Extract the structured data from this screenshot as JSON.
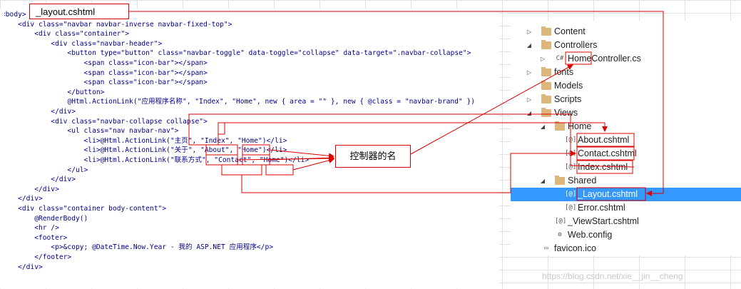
{
  "title_box": "_layout.cshtml",
  "callout": "控制器的名",
  "code_lines": [
    "<body>",
    "    <div class=\"navbar navbar-inverse navbar-fixed-top\">",
    "        <div class=\"container\">",
    "            <div class=\"navbar-header\">",
    "                <button type=\"button\" class=\"navbar-toggle\" data-toggle=\"collapse\" data-target=\".navbar-collapse\">",
    "                    <span class=\"icon-bar\"></span>",
    "                    <span class=\"icon-bar\"></span>",
    "                    <span class=\"icon-bar\"></span>",
    "                </button>",
    "                @Html.ActionLink(\"应用程序名称\", \"Index\", \"Home\", new { area = \"\" }, new { @class = \"navbar-brand\" })",
    "            </div>",
    "            <div class=\"navbar-collapse collapse\">",
    "                <ul class=\"nav navbar-nav\">",
    "                    <li>@Html.ActionLink(\"主页\", \"Index\", \"Home\")</li>",
    "                    <li>@Html.ActionLink(\"关于\", \"About\", \"Home\")</li>",
    "                    <li>@Html.ActionLink(\"联系方式\", \"Contact\", \"Home\")</li>",
    "                </ul>",
    "            </div>",
    "        </div>",
    "    </div>",
    "    <div class=\"container body-content\">",
    "        @RenderBody()",
    "        <hr />",
    "        <footer>",
    "            <p>&copy; @DateTime.Now.Year - 我的 ASP.NET 应用程序</p>",
    "        </footer>",
    "    </div>"
  ],
  "tree": [
    {
      "label": "Content",
      "type": "folder",
      "level": 1,
      "arrow": "collapsed"
    },
    {
      "label": "Controllers",
      "type": "folder",
      "level": 1,
      "arrow": "expanded"
    },
    {
      "label": "HomeController.cs",
      "type": "cs-file",
      "level": 2,
      "arrow": "collapsed"
    },
    {
      "label": "fonts",
      "type": "folder",
      "level": 1,
      "arrow": "collapsed"
    },
    {
      "label": "Models",
      "type": "folder",
      "level": 1,
      "arrow": "none"
    },
    {
      "label": "Scripts",
      "type": "folder",
      "level": 1,
      "arrow": "collapsed"
    },
    {
      "label": "Views",
      "type": "folder",
      "level": 1,
      "arrow": "expanded"
    },
    {
      "label": "Home",
      "type": "folder",
      "level": 2,
      "arrow": "expanded"
    },
    {
      "label": "About.cshtml",
      "type": "cshtml-file",
      "level": 3,
      "arrow": "none"
    },
    {
      "label": "Contact.cshtml",
      "type": "cshtml-file",
      "level": 3,
      "arrow": "none"
    },
    {
      "label": "Index.cshtml",
      "type": "cshtml-file",
      "level": 3,
      "arrow": "none"
    },
    {
      "label": "Shared",
      "type": "folder",
      "level": 2,
      "arrow": "expanded"
    },
    {
      "label": "_Layout.cshtml",
      "type": "cshtml-file",
      "level": 3,
      "arrow": "none",
      "selected": true
    },
    {
      "label": "Error.cshtml",
      "type": "cshtml-file",
      "level": 3,
      "arrow": "none"
    },
    {
      "label": "_ViewStart.cshtml",
      "type": "cshtml-file",
      "level": 2,
      "arrow": "none"
    },
    {
      "label": "Web.config",
      "type": "config-file",
      "level": 2,
      "arrow": "none"
    },
    {
      "label": "favicon.ico",
      "type": "ico-file",
      "level": 1,
      "arrow": "none"
    }
  ],
  "watermark": "https://blog.csdn.net/xie__jin__cheng",
  "colors": {
    "annotation": "#dd0000",
    "selection": "#3399ff",
    "folder": "#dcb67a"
  }
}
